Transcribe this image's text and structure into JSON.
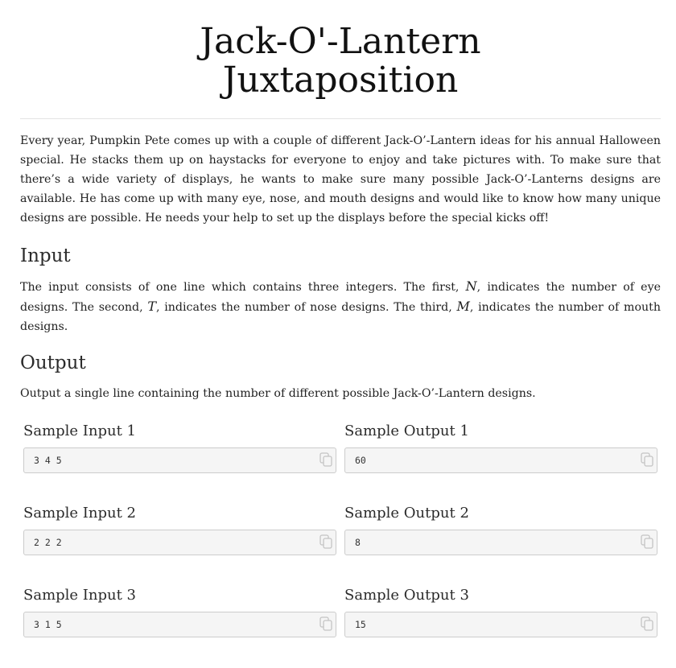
{
  "title_line1": "Jack-O'-Lantern",
  "title_line2": "Juxtaposition",
  "intro": "Every year, Pumpkin Pete comes up with a couple of different Jack-O’-Lantern ideas for his annual Halloween special. He stacks them up on haystacks for everyone to enjoy and take pictures with. To make sure that there’s a wide variety of displays, he wants to make sure many possible Jack-O’-Lanterns designs are available. He has come up with many eye, nose, and mouth designs and would like to know how many unique designs are possible. He needs your help to set up the displays before the special kicks off!",
  "input": {
    "heading": "Input",
    "part1": "The input consists of one line which contains three integers. The first, ",
    "var1": "N",
    "part2": ", indicates the number of eye designs. The second, ",
    "var2": "T",
    "part3": ", indicates the number of nose designs. The third, ",
    "var3": "M",
    "part4": ", indicates the number of mouth designs."
  },
  "output": {
    "heading": "Output",
    "text": "Output a single line containing the number of different possible Jack-O’-Lantern designs."
  },
  "samples": [
    {
      "input_label": "Sample Input 1",
      "input_value": "3 4 5",
      "output_label": "Sample Output 1",
      "output_value": "60"
    },
    {
      "input_label": "Sample Input 2",
      "input_value": "2 2 2",
      "output_label": "Sample Output 2",
      "output_value": "8"
    },
    {
      "input_label": "Sample Input 3",
      "input_value": "3 1 5",
      "output_label": "Sample Output 3",
      "output_value": "15"
    }
  ],
  "icons": {
    "copy": "copy-icon"
  }
}
